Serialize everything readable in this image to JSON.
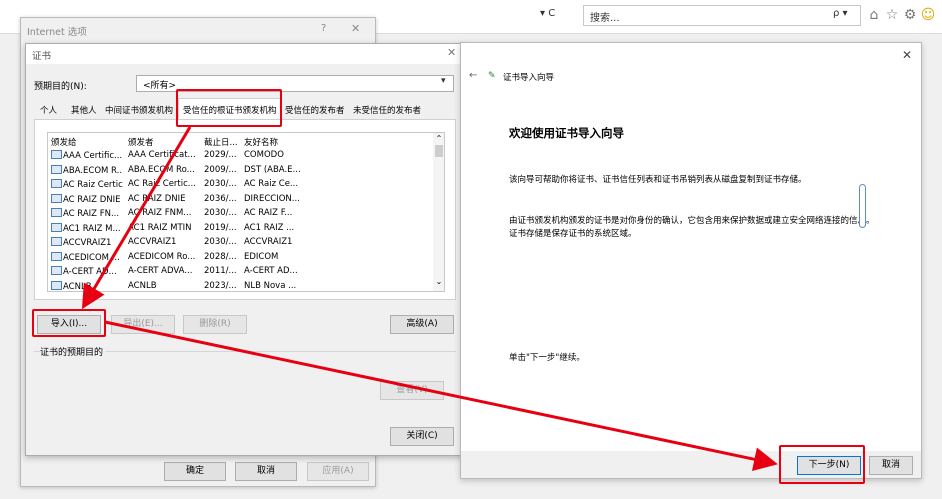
{
  "browser": {
    "address_tail": "▾ C",
    "search_placeholder": "搜索...",
    "search_button": "ρ ▾",
    "icons": [
      "home-icon",
      "star-icon",
      "gear-icon",
      "smiley-icon"
    ]
  },
  "internet_options": {
    "title": "Internet 选项",
    "help": "?",
    "close": "✕",
    "ok_label": "确定",
    "cancel_label": "取消",
    "apply_label": "应用(A)"
  },
  "certificates": {
    "title": "证书",
    "close": "✕",
    "purpose_label": "预期目的(N):",
    "purpose_value": "<所有>",
    "tabs": [
      "个人",
      "其他人",
      "中间证书颁发机构",
      "受信任的根证书颁发机构",
      "受信任的发布者",
      "未受信任的发布者"
    ],
    "active_tab": 3,
    "columns": [
      "颁发给",
      "颁发者",
      "截止日...",
      "友好名称"
    ],
    "rows": [
      [
        "AAA Certific...",
        "AAA Certificat...",
        "2029/...",
        "COMODO"
      ],
      [
        "ABA.ECOM R...",
        "ABA.ECOM Ro...",
        "2009/...",
        "DST (ABA.E..."
      ],
      [
        "AC Raiz Certic...",
        "AC Raiz Certic...",
        "2030/...",
        "AC Raiz Ce..."
      ],
      [
        "AC RAIZ DNIE",
        "AC RAIZ DNIE",
        "2036/...",
        "DIRECCION..."
      ],
      [
        "AC RAIZ FN...",
        "AC RAIZ FNM...",
        "2030/...",
        "AC RAIZ F..."
      ],
      [
        "AC1 RAIZ M...",
        "AC1 RAIZ MTIN",
        "2019/...",
        "AC1 RAIZ ..."
      ],
      [
        "ACCVRAIZ1",
        "ACCVRAIZ1",
        "2030/...",
        "ACCVRAIZ1"
      ],
      [
        "ACEDICOM ...",
        "ACEDICOM Ro...",
        "2028/...",
        "EDICOM"
      ],
      [
        "A-CERT AD...",
        "A-CERT ADVA...",
        "2011/...",
        "A-CERT AD..."
      ],
      [
        "ACNLB",
        "ACNLB",
        "2023/...",
        "NLB Nova ..."
      ]
    ],
    "import_label": "导入(I)...",
    "export_label": "导出(E)...",
    "remove_label": "删除(R)",
    "advanced_label": "高级(A)",
    "purposes_section": "证书的预期目的",
    "view_label": "查看(V)",
    "close_label": "关闭(C)"
  },
  "wizard": {
    "close": "✕",
    "back": "←",
    "title": "证书导入向导",
    "heading": "欢迎使用证书导入向导",
    "desc1": "该向导可帮助你将证书、证书信任列表和证书吊销列表从磁盘复制到证书存储。",
    "desc2": "由证书颁发机构颁发的证书是对你身份的确认，它包含用来保护数据或建立安全网络连接的信息。证书存储是保存证书的系统区域。",
    "hint": "单击\"下一步\"继续。",
    "next_label": "下一步(N)",
    "cancel_label": "取消"
  },
  "colors": {
    "annotation": "#e60012"
  }
}
